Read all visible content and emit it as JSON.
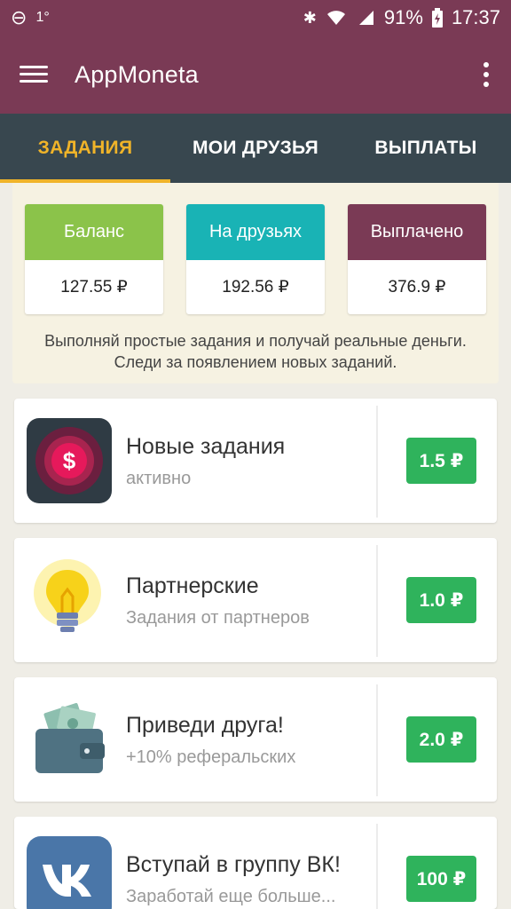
{
  "status_bar": {
    "notif1": "⊖",
    "notif2": "1°",
    "bluetooth": "✱",
    "battery": "91%",
    "time": "17:37"
  },
  "app_bar": {
    "title": "AppMoneta"
  },
  "tabs": [
    {
      "label": "ЗАДАНИЯ",
      "active": true
    },
    {
      "label": "МОИ ДРУЗЬЯ",
      "active": false
    },
    {
      "label": "ВЫПЛАТЫ",
      "active": false
    }
  ],
  "summary": {
    "cards": [
      {
        "label": "Баланс",
        "value": "127.55 ₽",
        "color": "#8bc34a"
      },
      {
        "label": "На друзьях",
        "value": "192.56 ₽",
        "color": "#19b3b5"
      },
      {
        "label": "Выплачено",
        "value": "376.9 ₽",
        "color": "#7a3a55"
      }
    ],
    "text": "Выполняй простые задания и получай реальные деньги. Следи за появлением новых заданий."
  },
  "items": [
    {
      "title": "Новые задания",
      "subtitle": "активно",
      "price": "1.5 ₽",
      "icon": "dollar-coin-icon"
    },
    {
      "title": "Партнерские",
      "subtitle": "Задания от партнеров",
      "price": "1.0 ₽",
      "icon": "lightbulb-icon"
    },
    {
      "title": "Приведи друга!",
      "subtitle": "+10% реферальских",
      "price": "2.0 ₽",
      "icon": "wallet-icon"
    },
    {
      "title": "Вступай в группу ВК!",
      "subtitle": "Заработай еще больше...",
      "price": "100 ₽",
      "icon": "vk-icon"
    }
  ],
  "colors": {
    "primary": "#7a3a55",
    "tab_bar": "#38474f",
    "accent": "#f0b429",
    "price_green": "#2fb35c"
  }
}
